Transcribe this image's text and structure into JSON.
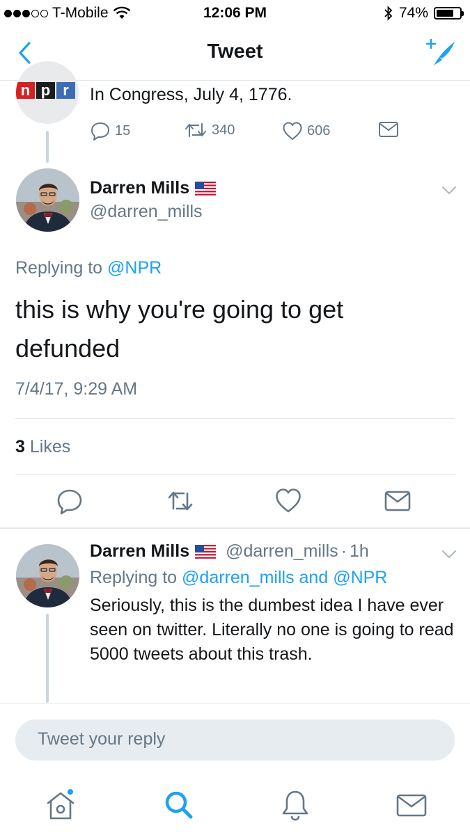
{
  "status_bar": {
    "carrier": "T-Mobile",
    "time": "12:06 PM",
    "battery": "74%",
    "battery_level": 0.74,
    "signal_bars": 3
  },
  "nav": {
    "title": "Tweet",
    "back_icon": "chevron-left-icon",
    "compose_icon": "compose-tweet-icon"
  },
  "parent_tweet": {
    "logo_letters": [
      "n",
      "p",
      "r"
    ],
    "text": "In Congress, July 4, 1776.",
    "replies": "15",
    "retweets": "340",
    "likes": "606"
  },
  "main_tweet": {
    "name": "Darren Mills",
    "handle": "@darren_mills",
    "replying_label": "Replying to",
    "replying_to": "@NPR",
    "text": "this is why you're going to get defunded",
    "timestamp": "7/4/17, 9:29 AM",
    "likes_count": "3",
    "likes_label": "Likes"
  },
  "reply_tweet": {
    "name": "Darren Mills",
    "handle": "@darren_mills",
    "time": "1h",
    "separator": "·",
    "replying_label": "Replying to",
    "replying_to_1": "@darren_mills",
    "replying_and": "and",
    "replying_to_2": "@NPR",
    "text": "Seriously, this is the dumbest idea I have ever seen on twitter. Literally no one is going to read 5000 tweets about this trash."
  },
  "composer": {
    "placeholder": "Tweet your reply"
  },
  "tabbar": {
    "items": [
      "home-icon",
      "search-icon",
      "notifications-icon",
      "messages-icon"
    ]
  },
  "colors": {
    "accent": "#1da1f2",
    "secondary_text": "#657786",
    "divider": "#e1e8ed"
  }
}
